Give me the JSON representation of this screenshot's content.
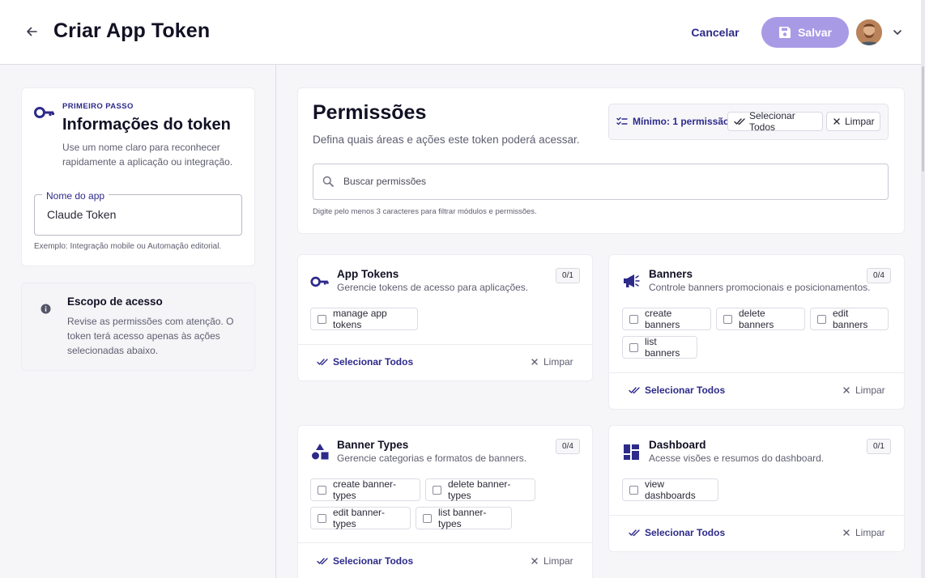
{
  "header": {
    "title": "Criar App Token",
    "cancel_label": "Cancelar",
    "save_label": "Salvar"
  },
  "info_card": {
    "step": "PRIMEIRO PASSO",
    "title": "Informações do token",
    "description": "Use um nome claro para reconhecer rapidamente a aplicação ou integração.",
    "field_label": "Nome do app",
    "field_value": "Claude Token",
    "field_hint": "Exemplo: Integração mobile ou Automação editorial."
  },
  "scope_card": {
    "title": "Escopo de acesso",
    "description": "Revise as permissões com atenção. O token terá acesso apenas às ações selecionadas abaixo."
  },
  "permissions": {
    "title": "Permissões",
    "description": "Defina quais áreas e ações este token poderá acessar.",
    "minimum": "Mínimo: 1 permissão",
    "select_all": "Selecionar Todos",
    "clear": "Limpar",
    "search_placeholder": "Buscar permissões",
    "search_hint": "Digite pelo menos 3 caracteres para filtrar módulos e permissões."
  },
  "modules": [
    {
      "title": "App Tokens",
      "description": "Gerencie tokens de acesso para aplicações.",
      "count": "0/1",
      "icon": "key-icon",
      "permissions": [
        "manage app tokens"
      ],
      "select_all": "Selecionar Todos",
      "clear": "Limpar"
    },
    {
      "title": "Banners",
      "description": "Controle banners promocionais e posicionamentos.",
      "count": "0/4",
      "icon": "megaphone-icon",
      "permissions": [
        "create banners",
        "delete banners",
        "edit banners",
        "list banners"
      ],
      "select_all": "Selecionar Todos",
      "clear": "Limpar"
    },
    {
      "title": "Banner Types",
      "description": "Gerencie categorias e formatos de banners.",
      "count": "0/4",
      "icon": "shapes-icon",
      "permissions": [
        "create banner-types",
        "delete banner-types",
        "edit banner-types",
        "list banner-types"
      ],
      "select_all": "Selecionar Todos",
      "clear": "Limpar"
    },
    {
      "title": "Dashboard",
      "description": "Acesse visões e resumos do dashboard.",
      "count": "0/1",
      "icon": "dashboard-icon",
      "permissions": [
        "view dashboards"
      ],
      "select_all": "Selecionar Todos",
      "clear": "Limpar"
    }
  ],
  "colors": {
    "accent": "#2d2a8a",
    "save_button": "#a99ae6",
    "background": "#f6f6f9"
  }
}
